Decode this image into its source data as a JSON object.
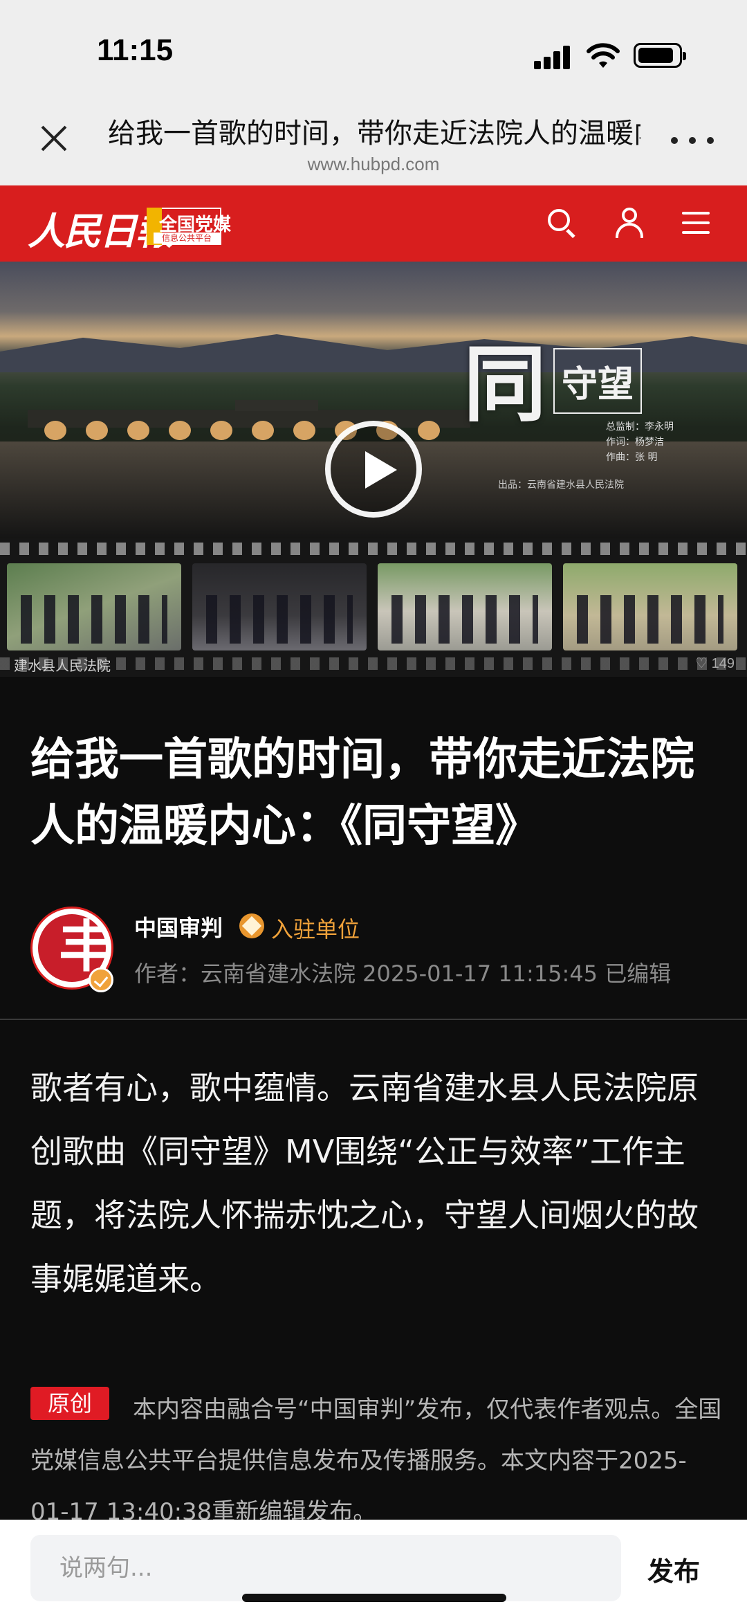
{
  "status_bar": {
    "time": "11:15"
  },
  "browser": {
    "title": "给我一首歌的时间，带你走近法院人的温暖内心：《同守望》",
    "url": "www.hubpd.com"
  },
  "site_header": {
    "logo_main": "人民日報",
    "logo_badge": "全国党媒",
    "logo_badge_sub": "信息公共平台",
    "accent_color": "#d81e1e"
  },
  "video": {
    "title_main": "同",
    "title_sub": "守望",
    "credits": [
      "总监制：李永明",
      "作词：杨梦洁",
      "作曲：张 明"
    ],
    "producer": "出品：云南省建水县人民法院",
    "account": "建水县人民法院",
    "likes": "149"
  },
  "article": {
    "title": "给我一首歌的时间，带你走近法院人的温暖内心：《同守望》",
    "author_name": "中国审判",
    "badge_text": "入驻单位",
    "author_meta": "作者：云南省建水法院   2025-01-17 11:15:45 已编辑",
    "body": "歌者有心，歌中蕴情。云南省建水县人民法院原创歌曲《同守望》MV围绕“公正与效率”工作主题，将法院人怀揣赤忱之心，守望人间烟火的故事娓娓道来。",
    "original_badge": "原创",
    "footnote": "本内容由融合号“中国审判”发布，仅代表作者观点。全国党媒信息公共平台提供信息发布及传播服务。本文内容于2025-01-17 13:40:38重新编辑发布。"
  },
  "comment_bar": {
    "placeholder": "说两句...",
    "publish_label": "发布"
  }
}
